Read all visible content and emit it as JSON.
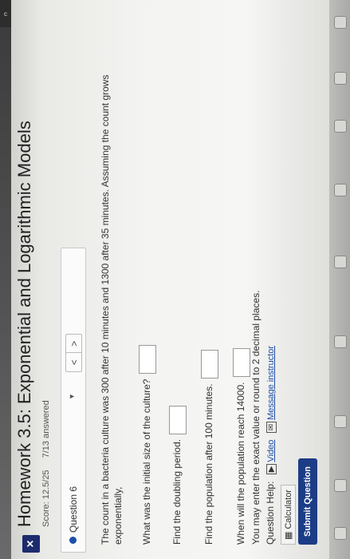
{
  "window": {
    "tab_letter": "c"
  },
  "header": {
    "close_label": "×",
    "title": "Homework 3.5: Exponential and Logarithmic Models",
    "score": "Score: 12.5/25",
    "answered": "7/13 answered"
  },
  "question_nav": {
    "label": "Question 6",
    "caret": "▼",
    "prev": "<",
    "next": ">"
  },
  "question": {
    "prompt": "The count in a bacteria culture was 300 after 10 minutes and 1300 after 35 minutes. Assuming the count grows exponentially,",
    "parts": [
      {
        "label": "What was the initial size of the culture?",
        "value": ""
      },
      {
        "label": "Find the doubling period.",
        "value": ""
      },
      {
        "label": "Find the population after 100 minutes.",
        "value": ""
      },
      {
        "label": "When will the population reach 14000.",
        "value": ""
      }
    ],
    "note": "You may enter the exact value or round to 2 decimal places."
  },
  "help": {
    "label": "Question Help:",
    "video": "Video",
    "message": "Message instructor",
    "calculator": "Calculator"
  },
  "submit_label": "Submit Question",
  "colors": {
    "accent": "#1d3c86",
    "link": "#1d4fa8"
  }
}
